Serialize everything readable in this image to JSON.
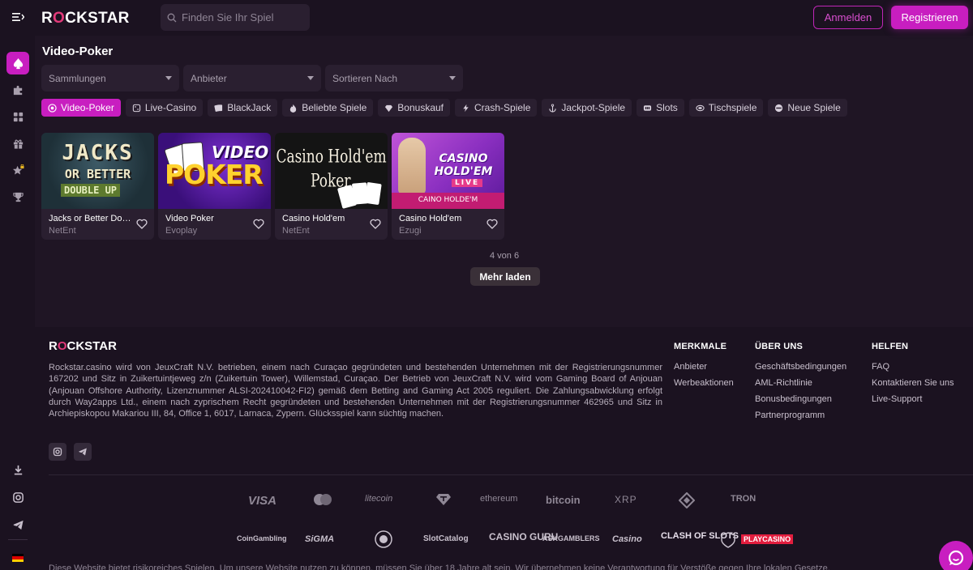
{
  "header": {
    "logo_pre": "R",
    "logo_o": "O",
    "logo_post": "CKSTAR",
    "search_placeholder": "Finden Sie Ihr Spiel",
    "login_label": "Anmelden",
    "register_label": "Registrieren"
  },
  "sidebar": {
    "items": [
      {
        "icon": "spade-icon",
        "active": true
      },
      {
        "icon": "puzzle-icon",
        "active": false
      },
      {
        "icon": "grid-icon",
        "active": false
      },
      {
        "icon": "gift-icon",
        "active": false
      },
      {
        "icon": "star-lock-icon",
        "active": false
      },
      {
        "icon": "trophy-icon",
        "active": false
      }
    ],
    "bottom_items": [
      "download-icon",
      "instagram-icon",
      "telegram-icon"
    ],
    "language_flag": "de"
  },
  "main": {
    "title": "Video-Poker",
    "filters": [
      {
        "label": "Sammlungen"
      },
      {
        "label": "Anbieter"
      },
      {
        "label": "Sortieren Nach"
      }
    ],
    "categories": [
      {
        "label": "Video-Poker",
        "icon": "poker-chip-icon",
        "active": true
      },
      {
        "label": "Live-Casino",
        "icon": "dice-icon"
      },
      {
        "label": "BlackJack",
        "icon": "cards-icon"
      },
      {
        "label": "Beliebte Spiele",
        "icon": "fire-icon"
      },
      {
        "label": "Bonuskauf",
        "icon": "diamond-icon"
      },
      {
        "label": "Crash-Spiele",
        "icon": "lightning-icon"
      },
      {
        "label": "Jackpot-Spiele",
        "icon": "anchor-icon"
      },
      {
        "label": "Slots",
        "icon": "slot-icon"
      },
      {
        "label": "Tischspiele",
        "icon": "table-icon"
      },
      {
        "label": "Neue Spiele",
        "icon": "new-icon"
      }
    ],
    "games": [
      {
        "name": "Jacks or Better Double Up",
        "provider": "NetEnt",
        "art_line1": "JACKS",
        "art_line2": "OR BETTER",
        "art_line3": "DOUBLE UP"
      },
      {
        "name": "Video Poker",
        "provider": "Evoplay",
        "art_line1": "VIDEO",
        "art_line2": "POKER"
      },
      {
        "name": "Casino Hold'em",
        "provider": "NetEnt",
        "art_line1": "Casino Hold'em",
        "art_line2": "Poker"
      },
      {
        "name": "Casino Hold'em",
        "provider": "Ezugi",
        "art_line1": "CASINO",
        "art_line2": "HOLD'EM",
        "art_line3": "LIVE",
        "art_line4": "CAINO HOLDE'M"
      }
    ],
    "count_text": "4 von 6",
    "load_more_label": "Mehr laden"
  },
  "footer": {
    "logo_pre": "R",
    "logo_o": "O",
    "logo_post": "CKSTAR",
    "legal_text": "Rockstar.casino wird von JeuxCraft N.V. betrieben, einem nach Curaçao gegründeten und bestehenden Unternehmen mit der Registrierungsnummer 167202 und Sitz in Zuikertuintjeweg z/n (Zuikertuin Tower), Willemstad, Curaçao. Der Betrieb von JeuxCraft N.V. wird vom Gaming Board of Anjouan (Anjouan Offshore Authority, Lizenznummer ALSI-202410042-FI2) gemäß dem Betting and Gaming Act 2005 reguliert. Die Zahlungsabwicklung erfolgt durch Way2apps Ltd., einem nach zyprischem Recht gegründeten und bestehenden Unternehmen mit der Registrierungsnummer 462965 und Sitz in Archiepiskopou Makariou III, 84, Office 1, 6017, Larnaca, Zypern. Glücksspiel kann süchtig machen.",
    "columns": [
      {
        "title": "MERKMALE",
        "links": [
          "Anbieter",
          "Werbeaktionen"
        ]
      },
      {
        "title": "ÜBER UNS",
        "links": [
          "Geschäftsbedingungen",
          "AML-Richtlinie",
          "Bonusbedingungen",
          "Partnerprogramm"
        ]
      },
      {
        "title": "HELFEN",
        "links": [
          "FAQ",
          "Kontaktieren Sie uns",
          "Live-Support"
        ]
      }
    ],
    "payments": [
      "VISA",
      "mastercard",
      "litecoin",
      "tether",
      "ethereum",
      "bitcoin",
      "XRP",
      "binance",
      "TRON"
    ],
    "partners": [
      "CoinGambling",
      "SiGMA",
      "casino-badge",
      "SlotCatalog",
      "CASINO GURU",
      "ASKGAMBLERS",
      "Casino",
      "CLASH OF SLOTS",
      "shield-badge",
      "PLAYCASINO"
    ],
    "disclaimer": "Diese Website bietet risikoreiches Spielen. Um unsere Website nutzen zu können, müssen Sie über 18 Jahre alt sein. Wir übernehmen keine Verantwortung für Verstöße gegen Ihre lokalen Gesetze."
  },
  "colors": {
    "accent": "#c81ec0",
    "background": "#1f1524",
    "panel": "#2a1f30",
    "logo_o": "#e33a7a"
  }
}
